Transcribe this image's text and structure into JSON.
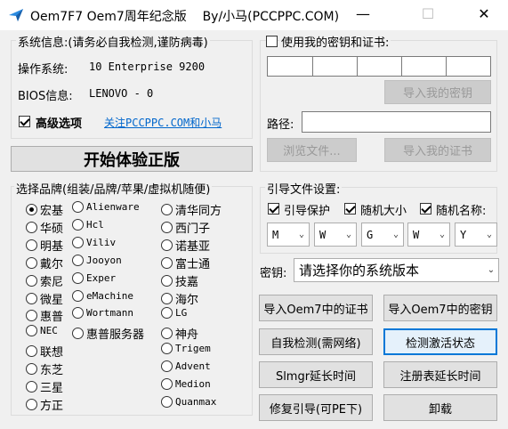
{
  "window": {
    "title": "Oem7F7 Oem7周年纪念版    By/小马(PCCPPC.COM)",
    "minimize": "—",
    "maximize": "☐",
    "close": "✕"
  },
  "sysinfo": {
    "group_label": "系统信息:(请务必自我检测,谨防病毒)",
    "os_label": "操作系统:",
    "os_value": "10 Enterprise 9200",
    "bios_label": "BIOS信息:",
    "bios_value": "LENOVO - 0",
    "advanced_label": "高级选项",
    "follow_link": "关注PCCPPC.COM和小马"
  },
  "start_button": "开始体验正版",
  "brand": {
    "group_label": "选择品牌(组装/品牌/苹果/虚拟机随便)",
    "col1": [
      "宏基",
      "华硕",
      "明基",
      "戴尔",
      "索尼",
      "微星",
      "惠普",
      "NEC",
      "联想",
      "东芝",
      "三星",
      "方正"
    ],
    "col2": [
      "Alienware",
      "Hcl",
      "Viliv",
      "Jooyon",
      "Exper",
      "eMachine",
      "Wortmann",
      "惠普服务器"
    ],
    "col3": [
      "清华同方",
      "西门子",
      "诺基亚",
      "富士通",
      "技嘉",
      "海尔",
      "LG",
      "神舟",
      "Trigem",
      "Advent",
      "Medion",
      "Quanmax"
    ]
  },
  "keycert": {
    "group_label": "使用我的密钥和证书:",
    "import_key": "导入我的密钥",
    "path_label": "路径:",
    "path_value": "",
    "browse": "浏览文件...",
    "import_cert": "导入我的证书"
  },
  "boot": {
    "group_label": "引导文件设置:",
    "protect": "引导保护",
    "random_size": "随机大小",
    "random_name": "随机名称:",
    "selects": [
      "M",
      "W",
      "G",
      "W",
      "Y"
    ]
  },
  "key_label": "密钥:",
  "key_select": "请选择你的系统版本",
  "actions": {
    "import_oem_cert": "导入Oem7中的证书",
    "import_oem_key": "导入Oem7中的密钥",
    "self_check": "自我检测(需网络)",
    "check_activation": "检测激活状态",
    "slmgr": "Slmgr延长时间",
    "registry": "注册表延长时间",
    "repair_boot": "修复引导(可PE下)",
    "uninstall": "卸载"
  }
}
